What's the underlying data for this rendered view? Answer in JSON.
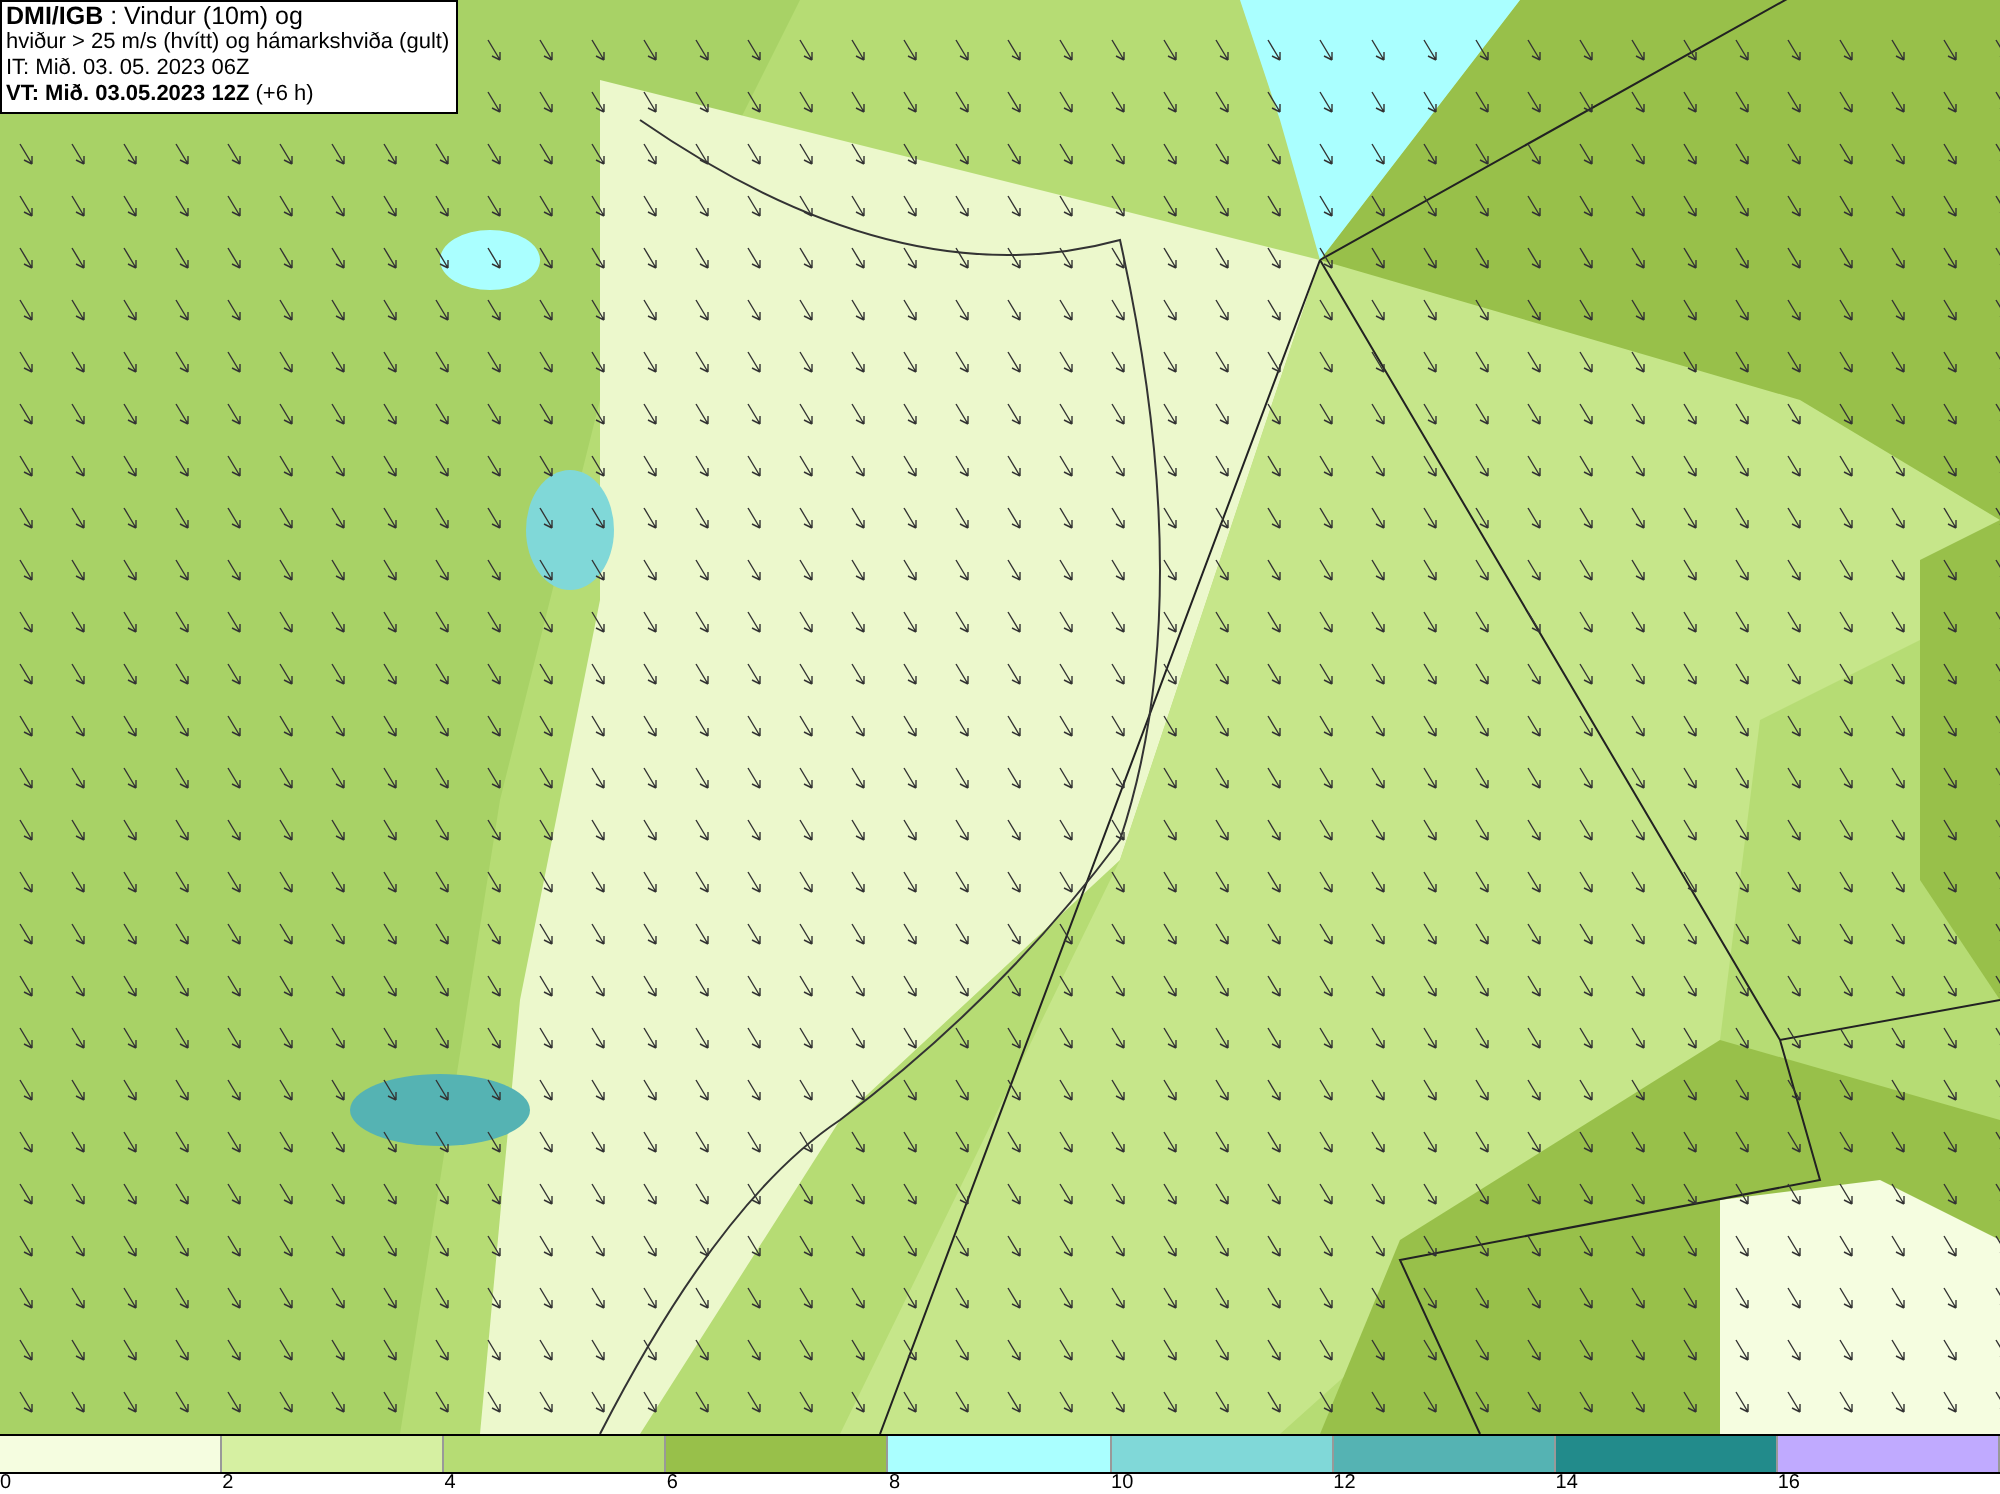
{
  "title_box": {
    "lines": [
      "**DMI/IGB** : Vindur (10m) og",
      "hviður > 25 m/s (hvítt) og hámarkshviða (gult)",
      "IT: Mið. 03. 05. 2023 06Z",
      "**VT: Mið. 03.05.2023 12Z** (+6 h)"
    ]
  },
  "legend": {
    "segments": [
      {
        "color": "#f5fde0",
        "label": "0"
      },
      {
        "color": "#d6f0a2",
        "label": "2"
      },
      {
        "color": "#b6dc74",
        "label": "4"
      },
      {
        "color": "#98c04a",
        "label": "6"
      },
      {
        "color": "#aaffff",
        "label": "8"
      },
      {
        "color": "#80d8d8",
        "label": "10"
      },
      {
        "color": "#55b3b3",
        "label": "12"
      },
      {
        "color": "#228b8b",
        "label": "14"
      },
      {
        "color": "#c0aaff",
        "label": "16"
      }
    ]
  }
}
